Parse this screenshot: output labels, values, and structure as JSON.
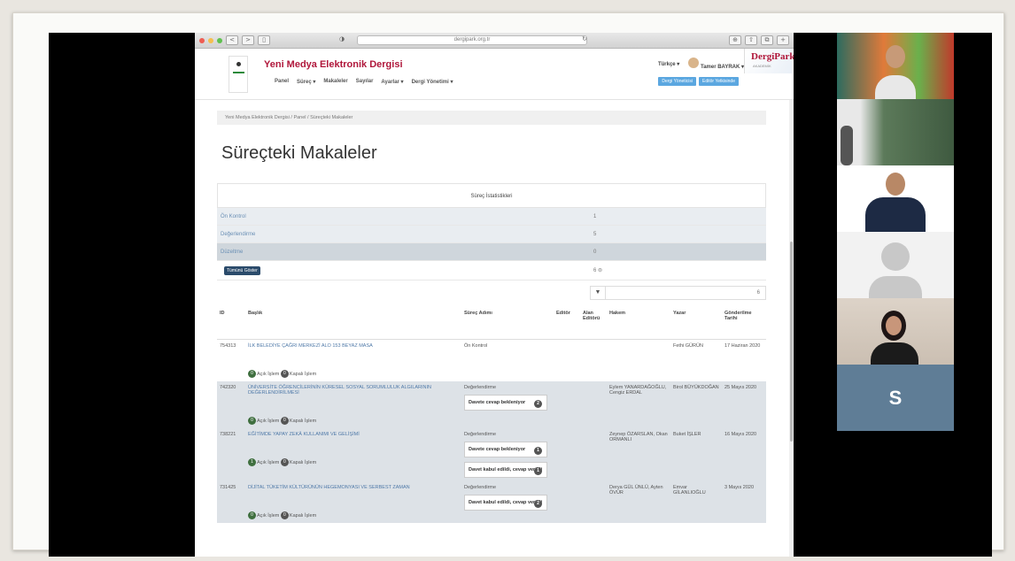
{
  "browser": {
    "url": "dergipark.org.tr",
    "back_glyph": "<",
    "forward_glyph": ">",
    "sidebar_glyph": "▯",
    "shield_glyph": "◑",
    "reload_glyph": "↻",
    "download_glyph": "⊕",
    "share_glyph": "⇧",
    "tabs_glyph": "⧉",
    "plus_glyph": "+"
  },
  "header": {
    "journal_title": "Yeni Medya Elektronik Dergisi",
    "nav": [
      "Panel",
      "Süreç ▾",
      "Makaleler",
      "Sayılar",
      "Ayarlar ▾",
      "Dergi Yönetimi ▾"
    ],
    "language": "Türkçe ▾",
    "user": "Tamer BAYRAK ▾",
    "pill_1": "Dergi Yöneticisi",
    "pill_2": "Editör Yetkisinde",
    "brand": "DergiPark",
    "brand_sub": "AKADEMİK"
  },
  "breadcrumb": "Yeni Medya Elektronik Dergisi  /  Panel  /  Süreçteki Makaleler",
  "page_title": "Süreçteki Makaleler",
  "stats": {
    "heading": "Süreç İstatistikleri",
    "rows": [
      {
        "label": "Ön Kontrol",
        "value": "1"
      },
      {
        "label": "Değerlendirme",
        "value": "5"
      },
      {
        "label": "Düzeltme",
        "value": "0"
      }
    ],
    "all_button": "Tümünü Göster",
    "total": "6 ⊜"
  },
  "filter": {
    "icon": "▼",
    "placeholder": "",
    "page": "6"
  },
  "table": {
    "headers": [
      "ID",
      "Başlık",
      "Süreç Adımı",
      "Editör",
      "Alan Editörü",
      "Hakem",
      "Yazar",
      "Gönderilme Tarihi"
    ],
    "rows": [
      {
        "id": "754313",
        "title": "İLK BELEDİYE ÇAĞRI MERKEZİ ALO 153 BEYAZ MASA",
        "step": "Ön Kontrol",
        "cards": [],
        "referee": "",
        "author": "Fethi GÜRÜN",
        "date": "17 Haziran 2020",
        "open_count": "0",
        "closed_count": "0",
        "open_label": "Açık İşlem",
        "closed_label": "Kapalı İşlem"
      },
      {
        "id": "742320",
        "title": "ÜNİVERSİTE ÖĞRENCİLERİNİN KÜRESEL SOSYAL SORUMLULUK ALGILARININ DEĞERLENDİRİLMESİ",
        "step": "Değerlendirme",
        "cards": [
          {
            "text": "Davete cevap bekleniyor",
            "count": "2"
          }
        ],
        "referee": "Eylem YANARDAĞOĞLU, Cengiz ERDAL",
        "author": "Birol BÜYÜKDOĞAN",
        "date": "25 Mayıs 2020",
        "open_count": "0",
        "closed_count": "0",
        "open_label": "Açık İşlem",
        "closed_label": "Kapalı İşlem"
      },
      {
        "id": "738221",
        "title": "EĞİTİMDE YAPAY ZEKÂ KULLANIMI VE GELİŞİMİ",
        "step": "Değerlendirme",
        "cards": [
          {
            "text": "Davete cevap bekleniyor",
            "count": "1"
          },
          {
            "text": "Davet kabul edildi, cevap verildi",
            "count": "1"
          }
        ],
        "referee": "Zeynep ÖZARSLAN, Okan ORMANLI",
        "author": "Buket İŞLER",
        "date": "16 Mayıs 2020",
        "open_count": "1",
        "closed_count": "0",
        "open_label": "Açık İşlem",
        "closed_label": "Kapalı İşlem"
      },
      {
        "id": "731425",
        "title": "DİJİTAL TÜKETİM KÜLTÜRÜNÜN HEGEMONYASI VE SERBEST ZAMAN",
        "step": "Değerlendirme",
        "cards": [
          {
            "text": "Davet kabul edildi, cevap verildi",
            "count": "2"
          }
        ],
        "referee": "Derya GÜL ÜNLÜ, Ayten ÖVÜR",
        "author": "Emvar GİLANLIOĞLU",
        "date": "3 Mayıs 2020",
        "open_count": "0",
        "closed_count": "0",
        "open_label": "Açık İşlem",
        "closed_label": "Kapalı İşlem"
      }
    ]
  },
  "video_panel": {
    "tiles": [
      "participant-1",
      "participant-2",
      "participant-3",
      "participant-4",
      "participant-5",
      "participant-6"
    ],
    "initial": "S"
  }
}
